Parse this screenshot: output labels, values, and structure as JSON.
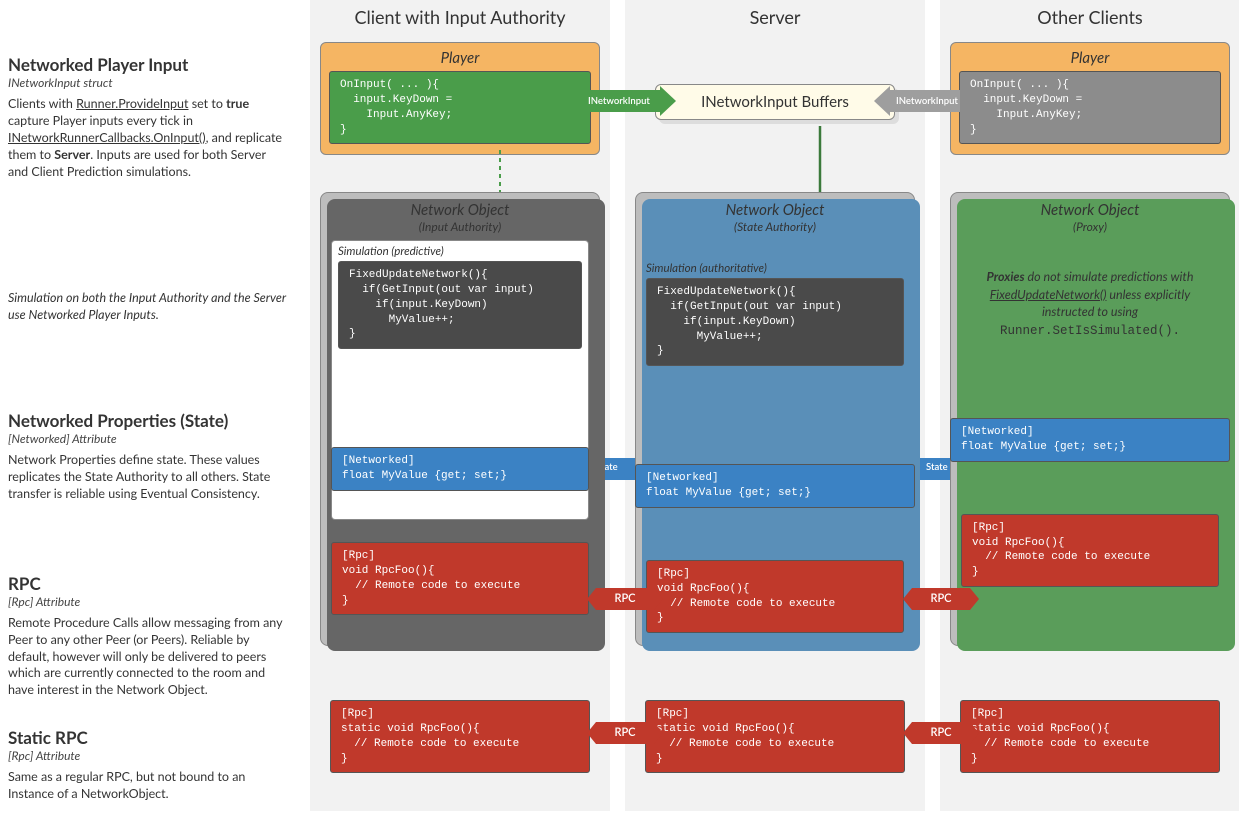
{
  "columns": {
    "client": "Client with Input Authority",
    "server": "Server",
    "other": "Other Clients"
  },
  "sections": {
    "input": {
      "title": "Networked Player Input",
      "sub": "INetworkInput struct",
      "body": "Clients with <u>Runner.ProvideInput</u> set to <b>true</b> capture Player inputs every tick in <u>INetworkRunnerCallbacks.OnInput()</u>, and replicate them to <b>Server</b>. Inputs are used for both Server and Client Prediction simulations."
    },
    "sim": {
      "body": "Simulation on both the Input Authority and the Server use Networked Player Inputs."
    },
    "props": {
      "title": "Networked Properties (State)",
      "sub": "[Networked] Attribute",
      "body": "Network Properties define state. These values replicates the State Authority to all others. State transfer is reliable using Eventual Consistency."
    },
    "rpc": {
      "title": "RPC",
      "sub": "[Rpc] Attribute",
      "body": "Remote Procedure Calls allow messaging from any Peer to any other Peer (or Peers). Reliable by default, however will only be delivered to peers which are currently connected to the room and have interest in  the Network Object."
    },
    "srpc": {
      "title": "Static RPC",
      "sub": "[Rpc] Attribute",
      "body": "Same as a regular RPC, but not bound to an Instance of a NetworkObject."
    }
  },
  "player": {
    "title": "Player",
    "code": "OnInput( ... ){\n  input.KeyDown =\n    Input.AnyKey;\n}"
  },
  "buffer": "INetworkInput Buffers",
  "netobj": {
    "title": "Network Object",
    "inputAuth": "(Input Authority)",
    "stateAuth": "(State Authority)",
    "proxy": "(Proxy)",
    "simPred": "Simulation (predictive)",
    "simAuth": "Simulation (authoritative)",
    "funCode": "FixedUpdateNetwork(){\n  if(GetInput(out var input)\n    if(input.KeyDown)\n      MyValue++;\n}",
    "proxyNote": "<b>Proxies</b> do not simulate predictions with <u>FixedUpdateNetwork()</u> unless explicitly instructed to using",
    "proxyCode": "Runner.SetIsSimulated()."
  },
  "networked": "[Networked]\nfloat MyValue {get; set;}",
  "rpcCode": "[Rpc]\nvoid RpcFoo(){\n  // Remote code to execute\n}",
  "srpcCode": "[Rpc]\nstatic void RpcFoo(){\n  // Remote code to execute\n}",
  "labels": {
    "inet": "INetworkInput",
    "state": "State",
    "rpc": "RPC"
  }
}
